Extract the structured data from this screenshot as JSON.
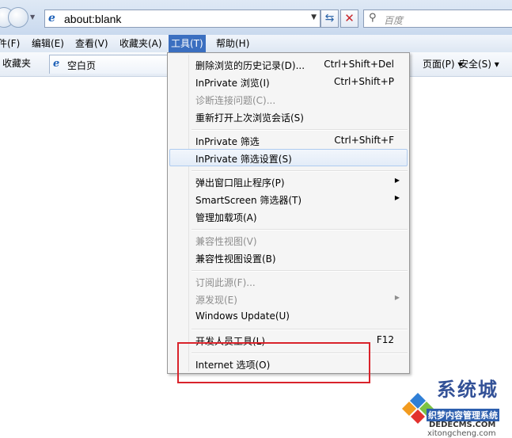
{
  "address_bar": {
    "url": "about:blank",
    "search_placeholder": "百度"
  },
  "menu_bar": {
    "items": [
      "件(F)",
      "编辑(E)",
      "查看(V)",
      "收藏夹(A)",
      "工具(T)",
      "帮助(H)"
    ],
    "active": "工具(T)"
  },
  "favorites_bar": {
    "favorites_label": "收藏夹",
    "tab_label": "空白页",
    "page_menu": "页面(P) ▾",
    "safety_menu": "安全(S) ▾"
  },
  "tools_menu": {
    "items": [
      {
        "label": "删除浏览的历史记录(D)...",
        "shortcut": "Ctrl+Shift+Del"
      },
      {
        "label": "InPrivate 浏览(I)",
        "shortcut": "Ctrl+Shift+P"
      },
      {
        "label": "诊断连接问题(C)...",
        "shortcut": ""
      },
      {
        "label": "重新打开上次浏览会话(S)",
        "shortcut": ""
      },
      {
        "label": "InPrivate 筛选",
        "shortcut": "Ctrl+Shift+F"
      },
      {
        "label": "InPrivate 筛选设置(S)",
        "shortcut": ""
      },
      {
        "label": "弹出窗口阻止程序(P)",
        "shortcut": ""
      },
      {
        "label": "SmartScreen 筛选器(T)",
        "shortcut": ""
      },
      {
        "label": "管理加载项(A)",
        "shortcut": ""
      },
      {
        "label": "兼容性视图(V)",
        "shortcut": ""
      },
      {
        "label": "兼容性视图设置(B)",
        "shortcut": ""
      },
      {
        "label": "订阅此源(F)...",
        "shortcut": ""
      },
      {
        "label": "源发现(E)",
        "shortcut": ""
      },
      {
        "label": "Windows Update(U)",
        "shortcut": ""
      },
      {
        "label": "开发人员工具(L)",
        "shortcut": "F12"
      },
      {
        "label": "Internet 选项(O)",
        "shortcut": ""
      }
    ]
  },
  "watermark": {
    "title": "系统城",
    "subtitle": "织梦内容管理系统",
    "site": "DEDECMS.COM",
    "bottom": "xitongcheng.com"
  }
}
